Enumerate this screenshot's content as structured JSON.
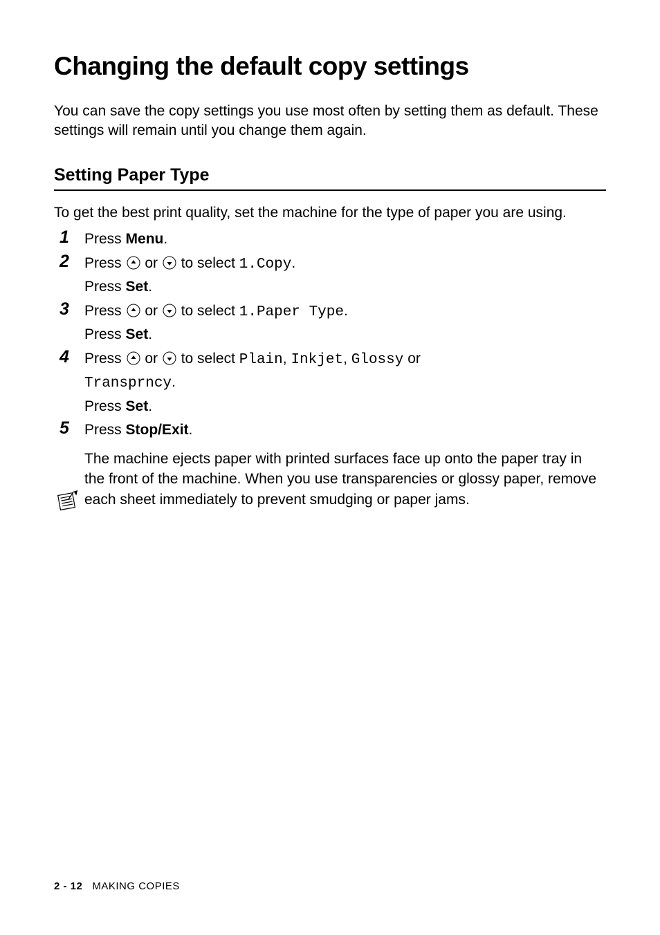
{
  "heading": "Changing the default copy settings",
  "intro": "You can save the copy settings you use most often by setting them as default. These settings will remain until you change them again.",
  "section_heading": "Setting Paper Type",
  "section_intro": "To get the best print quality, set the machine for the type of paper you are using.",
  "steps": {
    "n1": "1",
    "n2": "2",
    "n3": "3",
    "n4": "4",
    "n5": "5",
    "s1_press": "Press ",
    "s1_menu": "Menu",
    "s1_dot": ".",
    "s2_press1": "Press ",
    "s2_or": " or ",
    "s2_toselect": " to select ",
    "s2_opt": "1.Copy",
    "s2_dot": ".",
    "s2_press2": "Press ",
    "s2_set": "Set",
    "s2_dot2": ".",
    "s3_press1": "Press ",
    "s3_or": " or ",
    "s3_toselect": " to select ",
    "s3_opt": "1.Paper Type",
    "s3_dot": ".",
    "s3_press2": "Press ",
    "s3_set": "Set",
    "s3_dot2": ".",
    "s4_press1": "Press ",
    "s4_or": " or ",
    "s4_toselect": " to select ",
    "s4_opt1": "Plain",
    "s4_c1": ", ",
    "s4_opt2": "Inkjet",
    "s4_c2": ", ",
    "s4_opt3": "Glossy",
    "s4_or2": " or ",
    "s4_opt4": "Transprncy",
    "s4_dot": ".",
    "s4_press2": "Press ",
    "s4_set": "Set",
    "s4_dot2": ".",
    "s5_press": "Press ",
    "s5_stop": "Stop/Exit",
    "s5_dot": "."
  },
  "note": "The machine ejects paper with printed surfaces face up onto the paper tray in the front of the machine. When you use transparencies or glossy paper, remove each sheet immediately to prevent smudging or paper jams.",
  "footer_page": "2 - 12",
  "footer_section": "MAKING COPIES"
}
